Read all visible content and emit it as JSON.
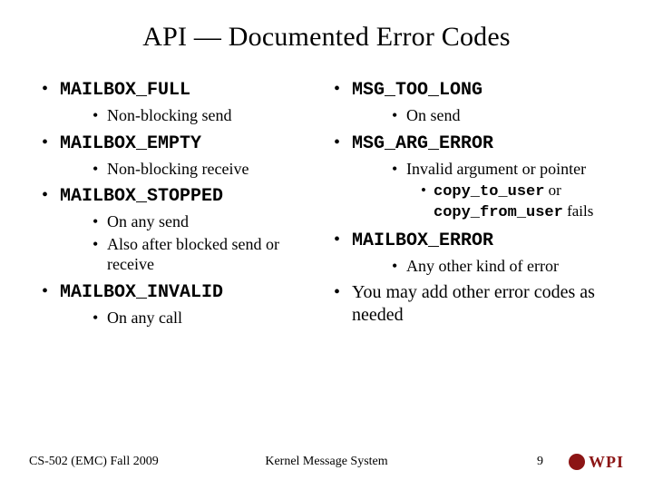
{
  "title": "API — Documented Error Codes",
  "left": {
    "items": [
      {
        "code": "MAILBOX_FULL",
        "subs": [
          "Non-blocking send"
        ]
      },
      {
        "code": "MAILBOX_EMPTY",
        "subs": [
          "Non-blocking receive"
        ]
      },
      {
        "code": "MAILBOX_STOPPED",
        "subs": [
          "On any send",
          "Also after blocked send or receive"
        ]
      },
      {
        "code": "MAILBOX_INVALID",
        "subs": [
          "On any call"
        ]
      }
    ]
  },
  "right": {
    "msg_too_long": {
      "code": "MSG_TOO_LONG",
      "sub": "On send"
    },
    "msg_arg_error": {
      "code": "MSG_ARG_ERROR",
      "sub_main": "Invalid argument or pointer",
      "sub2_code1": "copy_to_user",
      "sub2_mid": " or ",
      "sub2_code2": "copy_from_user",
      "sub2_tail": " fails"
    },
    "mailbox_error": {
      "code": "MAILBOX_ERROR",
      "sub": "Any other kind of error"
    },
    "extra": "You may add other error codes as needed"
  },
  "footer": {
    "left": "CS-502 (EMC) Fall 2009",
    "center": "Kernel Message System",
    "page": "9",
    "logo_text": "WPI"
  }
}
